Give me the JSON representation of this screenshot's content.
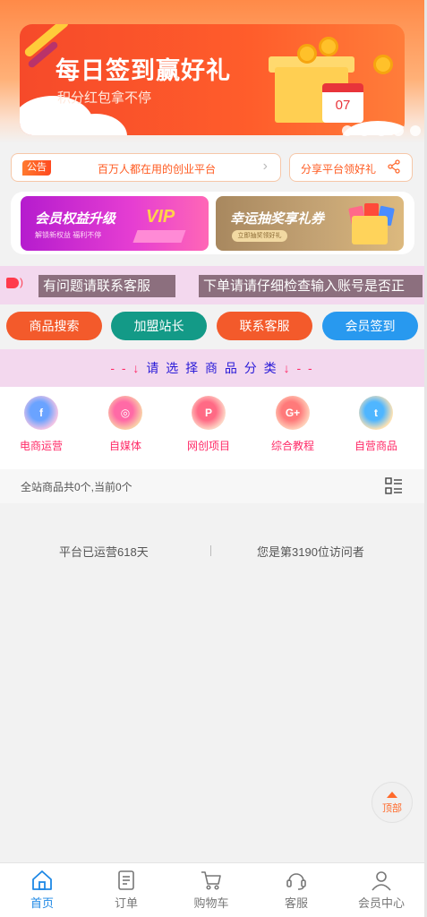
{
  "banner": {
    "title": "每日签到赢好礼",
    "subtitle": "积分红包拿不停",
    "calendar_day": "07"
  },
  "notice": {
    "tag": "公告",
    "text": "百万人都在用的创业平台",
    "arrow": "›"
  },
  "share": {
    "label": "分享平台领好礼",
    "icon": "share-icon"
  },
  "promos": [
    {
      "title": "会员权益升级",
      "subtitle": "解锁新权益 福利不停",
      "badge": "VIP"
    },
    {
      "title": "幸运抽奖享礼券",
      "subtitle": "立即抽奖领好礼"
    }
  ],
  "marquee": {
    "items": [
      "有问题请联系客服",
      "下单请请仔细检查输入账号是否正"
    ]
  },
  "actions": {
    "search": "商品搜索",
    "join": "加盟站长",
    "service": "联系客服",
    "sign": "会员签到"
  },
  "category_prompt": {
    "left": "- - ↓",
    "text": "请 选 择 商 品 分 类",
    "right": "↓ - -"
  },
  "categories": [
    {
      "label": "电商运营",
      "icon": "facebook-icon",
      "glyph": "f"
    },
    {
      "label": "自媒体",
      "icon": "instagram-icon",
      "glyph": "◎"
    },
    {
      "label": "网创项目",
      "icon": "pinterest-icon",
      "glyph": "P"
    },
    {
      "label": "综合教程",
      "icon": "google-plus-icon",
      "glyph": "G+"
    },
    {
      "label": "自营商品",
      "icon": "twitter-icon",
      "glyph": "t"
    }
  ],
  "products": {
    "count_text": "全站商品共0个,当前0个"
  },
  "stats": {
    "days": "平台已运营618天",
    "visitor": "您是第3190位访问者"
  },
  "back_to_top": "顶部",
  "nav": [
    {
      "label": "首页",
      "icon": "home-icon",
      "active": true
    },
    {
      "label": "订单",
      "icon": "order-icon",
      "active": false
    },
    {
      "label": "购物车",
      "icon": "cart-icon",
      "active": false
    },
    {
      "label": "客服",
      "icon": "headset-icon",
      "active": false
    },
    {
      "label": "会员中心",
      "icon": "user-icon",
      "active": false
    }
  ],
  "colors": {
    "accent_orange": "#f35a2b",
    "accent_teal": "#139a87",
    "accent_blue": "#2899ef",
    "category_pink": "#ff2a67",
    "nav_active": "#1e88e5"
  }
}
